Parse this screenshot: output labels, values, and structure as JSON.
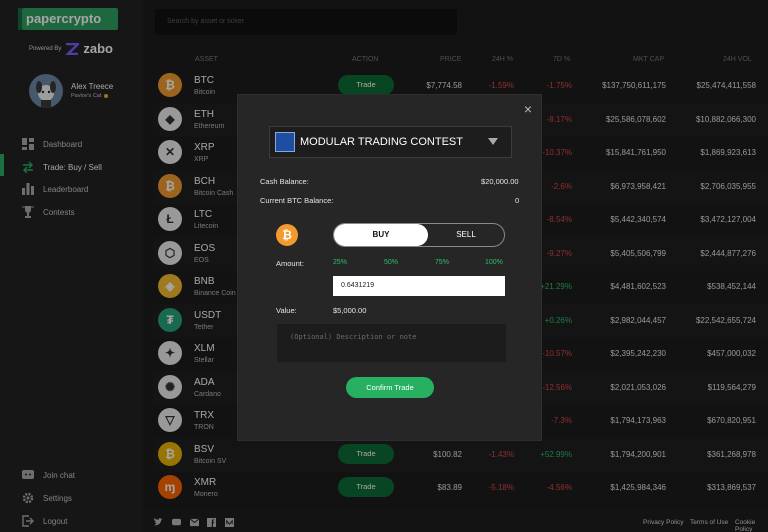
{
  "brand": {
    "logo_text": "papercrypto",
    "powered_by": "Powered By",
    "zabo": "zabo"
  },
  "user": {
    "name": "Alex Treece",
    "team": "Pavlov's Cat"
  },
  "nav": {
    "dashboard": "Dashboard",
    "trade": "Trade: Buy / Sell",
    "leaderboard": "Leaderboard",
    "contests": "Contests",
    "join_chat": "Join chat",
    "settings": "Settings",
    "logout": "Logout"
  },
  "search": {
    "placeholder": "Search by asset or ticker"
  },
  "table": {
    "headers": {
      "asset": "ASSET",
      "action": "ACTION",
      "price": "PRICE",
      "h24": "24H %",
      "d7": "7D %",
      "mktcap": "MKT CAP",
      "vol": "24H VOL"
    },
    "trade_label": "Trade",
    "rows": [
      {
        "sym": "BTC",
        "name": "Bitcoin",
        "color": "#f29a2e",
        "glyph": "₿",
        "price": "$7,774.58",
        "h24": "-1.59%",
        "d7": "-1.75%",
        "cap": "$137,750,611,175",
        "vol": "$25,474,411,558"
      },
      {
        "sym": "ETH",
        "name": "Ethereum",
        "color": "#ececec",
        "glyph": "◆",
        "price": "",
        "h24": "",
        "d7": "-8.17%",
        "cap": "$25,586,078,602",
        "vol": "$10,882,066,300"
      },
      {
        "sym": "XRP",
        "name": "XRP",
        "color": "#ececec",
        "glyph": "✕",
        "price": "",
        "h24": "",
        "d7": "-10.37%",
        "cap": "$15,841,761,950",
        "vol": "$1,869,923,613"
      },
      {
        "sym": "BCH",
        "name": "Bitcoin Cash",
        "color": "#f29a2e",
        "glyph": "₿",
        "price": "",
        "h24": "",
        "d7": "-2.6%",
        "cap": "$6,973,958,421",
        "vol": "$2,706,035,955"
      },
      {
        "sym": "LTC",
        "name": "Litecoin",
        "color": "#ececec",
        "glyph": "Ł",
        "price": "",
        "h24": "",
        "d7": "-8.54%",
        "cap": "$5,442,340,574",
        "vol": "$3,472,127,004"
      },
      {
        "sym": "EOS",
        "name": "EOS",
        "color": "#ececec",
        "glyph": "⬡",
        "price": "",
        "h24": "",
        "d7": "-9.27%",
        "cap": "$5,405,506,799",
        "vol": "$2,444,877,276"
      },
      {
        "sym": "BNB",
        "name": "Binance Coin",
        "color": "#f3ba2f",
        "glyph": "◈",
        "price": "",
        "h24": "",
        "d7": "+21.29%",
        "cap": "$4,481,602,523",
        "vol": "$538,452,144"
      },
      {
        "sym": "USDT",
        "name": "Tether",
        "color": "#26a17b",
        "glyph": "₮",
        "price": "",
        "h24": "",
        "d7": "+0.26%",
        "cap": "$2,982,044,457",
        "vol": "$22,542,655,724"
      },
      {
        "sym": "XLM",
        "name": "Stellar",
        "color": "#ececec",
        "glyph": "✦",
        "price": "",
        "h24": "",
        "d7": "-10.57%",
        "cap": "$2,395,242,230",
        "vol": "$457,000,032"
      },
      {
        "sym": "ADA",
        "name": "Cardano",
        "color": "#ececec",
        "glyph": "✺",
        "price": "",
        "h24": "",
        "d7": "-12.56%",
        "cap": "$2,021,053,026",
        "vol": "$119,564,279"
      },
      {
        "sym": "TRX",
        "name": "TRON",
        "color": "#ececec",
        "glyph": "▽",
        "price": "",
        "h24": "",
        "d7": "-7.3%",
        "cap": "$1,794,173,963",
        "vol": "$670,820,951"
      },
      {
        "sym": "BSV",
        "name": "Bitcoin SV",
        "color": "#eab300",
        "glyph": "₿",
        "price": "$100.82",
        "h24": "-1.43%",
        "d7": "+52.99%",
        "cap": "$1,794,200,901",
        "vol": "$361,268,978"
      },
      {
        "sym": "XMR",
        "name": "Monero",
        "color": "#ff6600",
        "glyph": "ɱ",
        "price": "$83.89",
        "h24": "-5.18%",
        "d7": "-4.56%",
        "cap": "$1,425,984,346",
        "vol": "$313,869,537"
      }
    ]
  },
  "footer": {
    "privacy": "Privacy Policy",
    "terms": "Terms of Use",
    "cookie": "Cookie Policy"
  },
  "modal": {
    "contest": "MODULAR TRADING CONTEST",
    "cash_label": "Cash Balance:",
    "cash_value": "$20,000.00",
    "btc_label": "Current BTC Balance:",
    "btc_value": "0",
    "buy": "BUY",
    "sell": "SELL",
    "amount_label": "Amount:",
    "pct": [
      "25%",
      "50%",
      "75%",
      "100%"
    ],
    "amount_value": "0.6431219",
    "value_label": "Value:",
    "value_value": "$5,000.00",
    "note_placeholder": "(Optional) Description or note",
    "confirm": "Confirm Trade",
    "close": "×"
  },
  "colors": {
    "accent": "#27b062",
    "negative": "#e04848",
    "positive": "#2fbf6a"
  }
}
